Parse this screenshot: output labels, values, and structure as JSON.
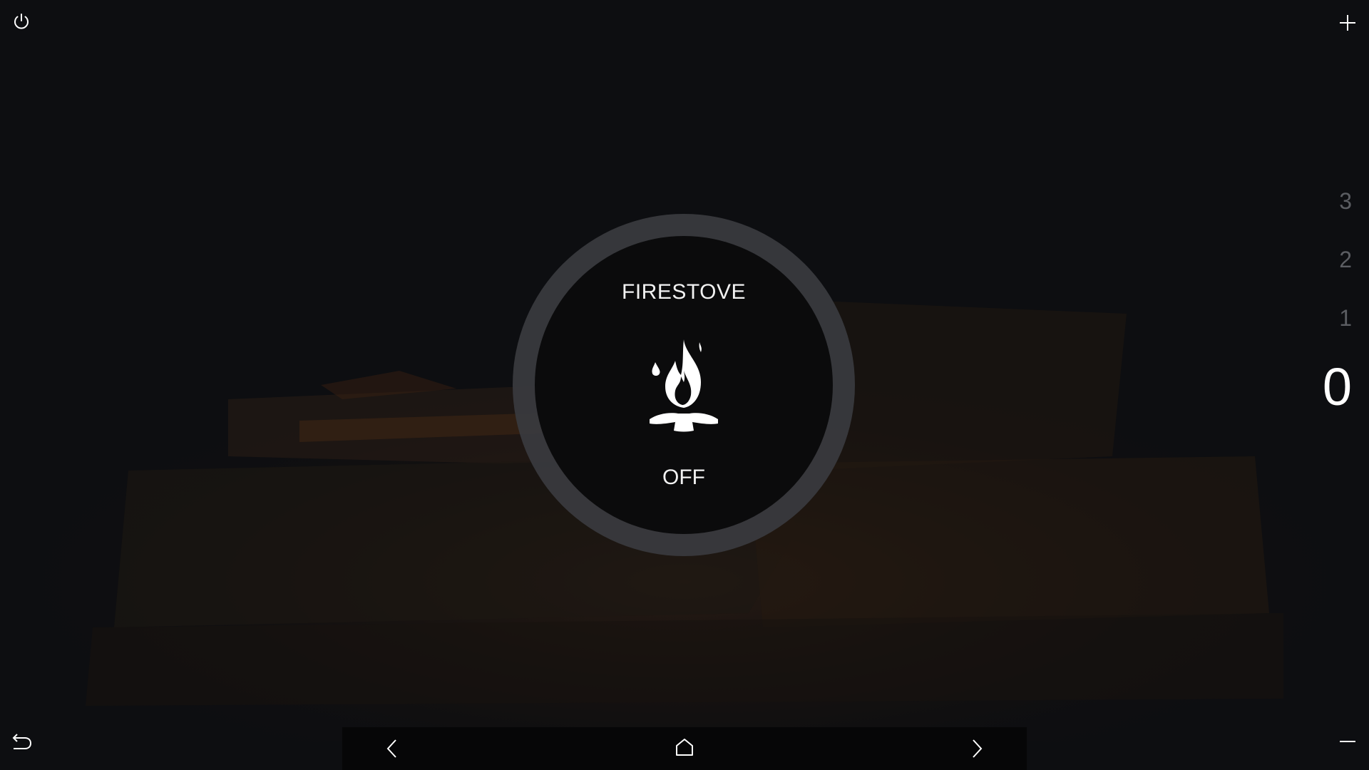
{
  "device": {
    "title": "FIRESTOVE",
    "status": "OFF",
    "icon": "campfire-icon"
  },
  "levels": {
    "items": [
      "3",
      "2",
      "1",
      "0"
    ],
    "active": "0"
  },
  "top_bar": {
    "left_icon": "power-icon",
    "right_icon": "plus-icon"
  },
  "bottom_bar": {
    "left_icon": "undo-icon",
    "right_icon": "minus-icon"
  },
  "nav_bar": {
    "prev_icon": "chevron-left-icon",
    "home_icon": "home-icon",
    "next_icon": "chevron-right-icon"
  },
  "colors": {
    "background": "#0d0e11",
    "dial_ring": "#3a3b3f",
    "dial_core": "#0b0b0c",
    "inactive_level": "#5b5d62",
    "active_level": "#ffffff"
  }
}
